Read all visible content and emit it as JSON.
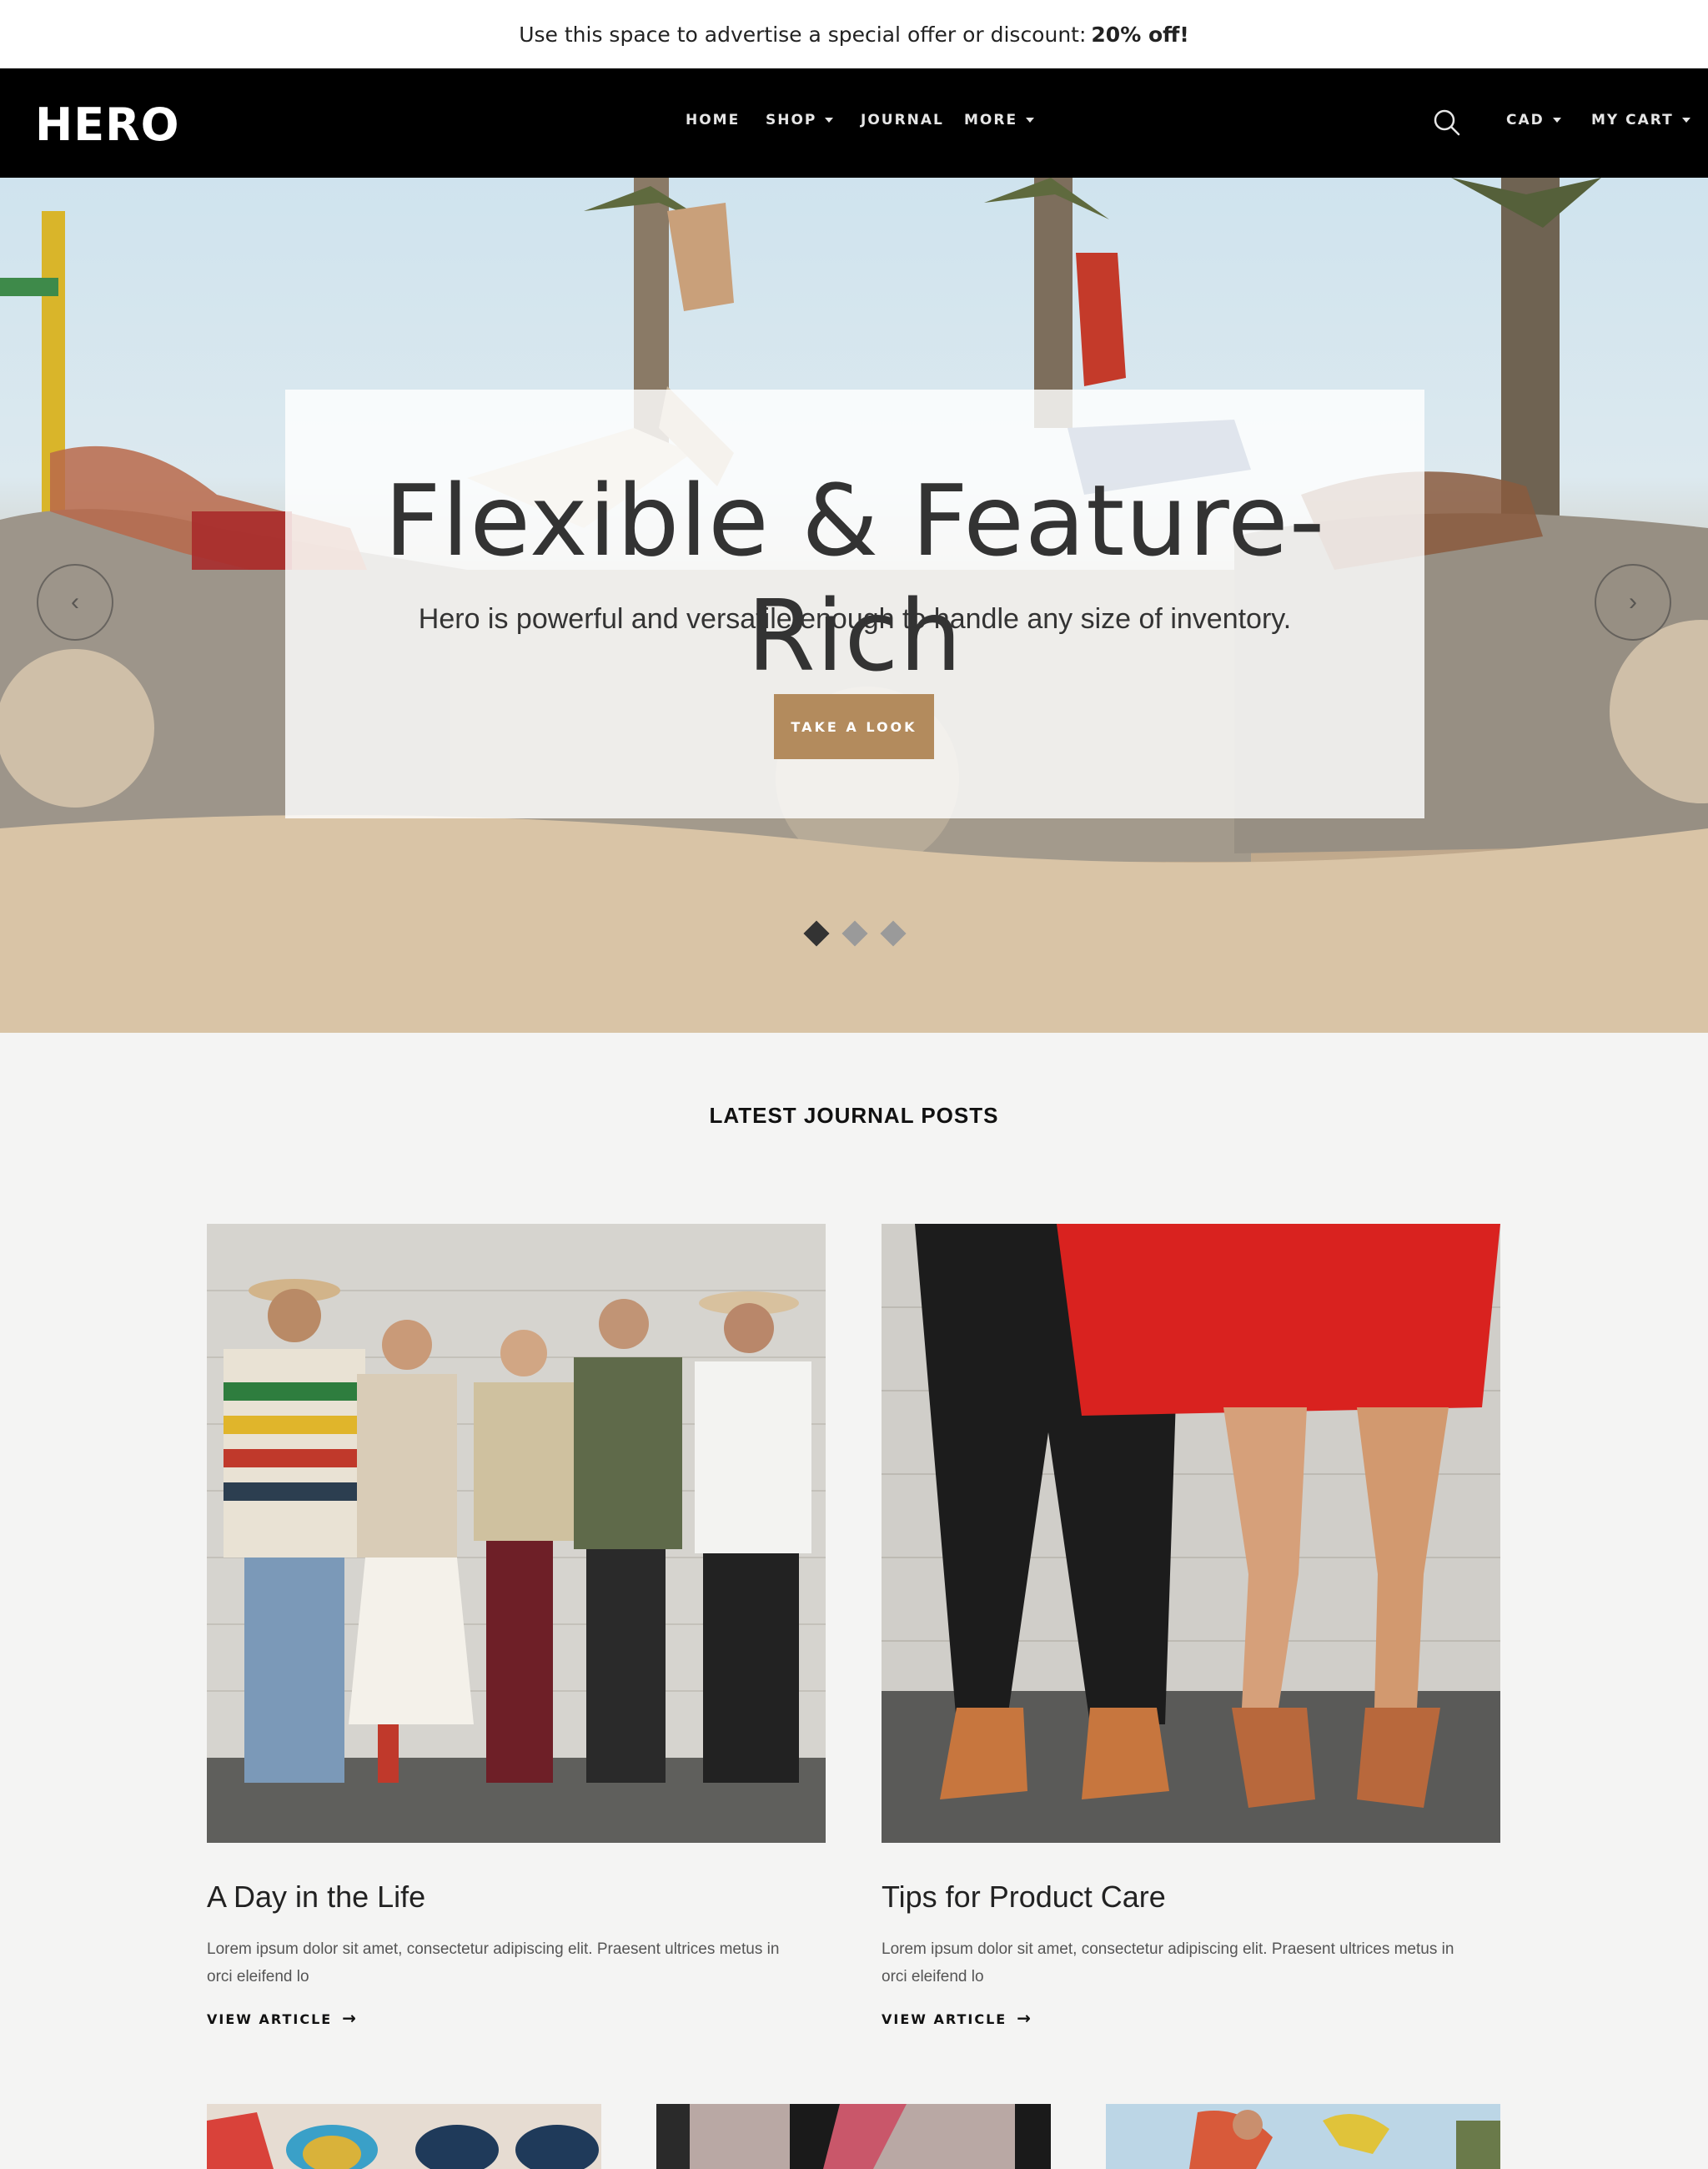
{
  "announcement": {
    "text": "Use this space to advertise a special offer or discount:",
    "highlight": "20% off!"
  },
  "header": {
    "logo": "HERO",
    "nav": [
      {
        "label": "HOME",
        "dropdown": false
      },
      {
        "label": "SHOP",
        "dropdown": true
      },
      {
        "label": "JOURNAL",
        "dropdown": false
      },
      {
        "label": "MORE",
        "dropdown": true
      }
    ],
    "currency": "CAD",
    "cart": "MY CART",
    "search_icon": "search-icon"
  },
  "hero": {
    "title": "Flexible & Feature-Rich",
    "subtitle": "Hero is powerful and versatile enough to handle any size of inventory.",
    "button": "TAKE A LOOK",
    "prev_icon": "chevron-left-icon",
    "next_icon": "chevron-right-icon",
    "slides_total": 3,
    "active_slide": 1,
    "colors": {
      "button": "#b38b5d",
      "dot_active": "#333333",
      "dot_inactive": "#9a9a9a"
    }
  },
  "journal": {
    "heading": "LATEST JOURNAL POSTS",
    "posts": [
      {
        "title": "A Day in the Life",
        "excerpt": "Lorem ipsum dolor sit amet, consectetur adipiscing elit. Praesent ultrices metus in orci eleifend lo",
        "link": "VIEW ARTICLE"
      },
      {
        "title": "Tips for Product Care",
        "excerpt": "Lorem ipsum dolor sit amet, consectetur adipiscing elit. Praesent ultrices metus in orci eleifend lo",
        "link": "VIEW ARTICLE"
      }
    ]
  }
}
